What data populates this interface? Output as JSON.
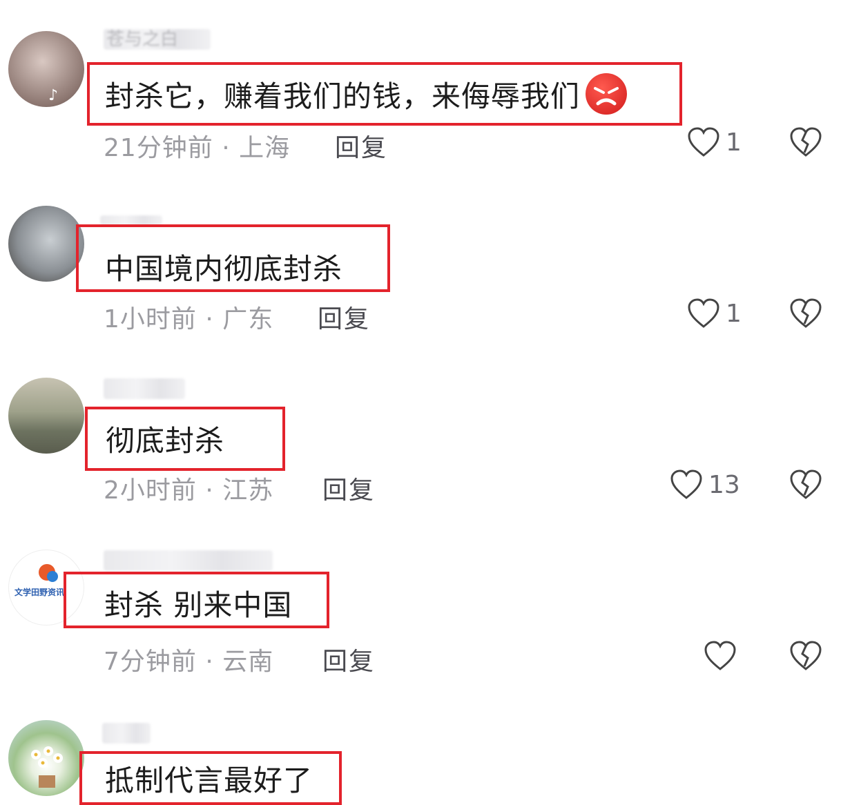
{
  "comments": [
    {
      "username": "苍与之白",
      "text": "封杀它，赚着我们的钱，来侮辱我们",
      "emoji": "angry-face-icon",
      "time": "21分钟前",
      "location": "上海",
      "reply": "回复",
      "likes": "1"
    },
    {
      "username": "",
      "text": "中国境内彻底封杀",
      "time": "1小时前",
      "location": "广东",
      "reply": "回复",
      "likes": "1"
    },
    {
      "username": "",
      "text": "彻底封杀",
      "time": "2小时前",
      "location": "江苏",
      "reply": "回复",
      "likes": "13"
    },
    {
      "username": "",
      "avatar_text": "文学田野资讯",
      "text": "封杀 别来中国",
      "time": "7分钟前",
      "location": "云南",
      "reply": "回复",
      "likes": ""
    },
    {
      "username": "",
      "text": "抵制代言最好了"
    }
  ],
  "separator": " · ",
  "colors": {
    "highlight_box": "#e3232c",
    "meta_text": "#9b9ba0",
    "reply_text": "#4a4a50"
  }
}
